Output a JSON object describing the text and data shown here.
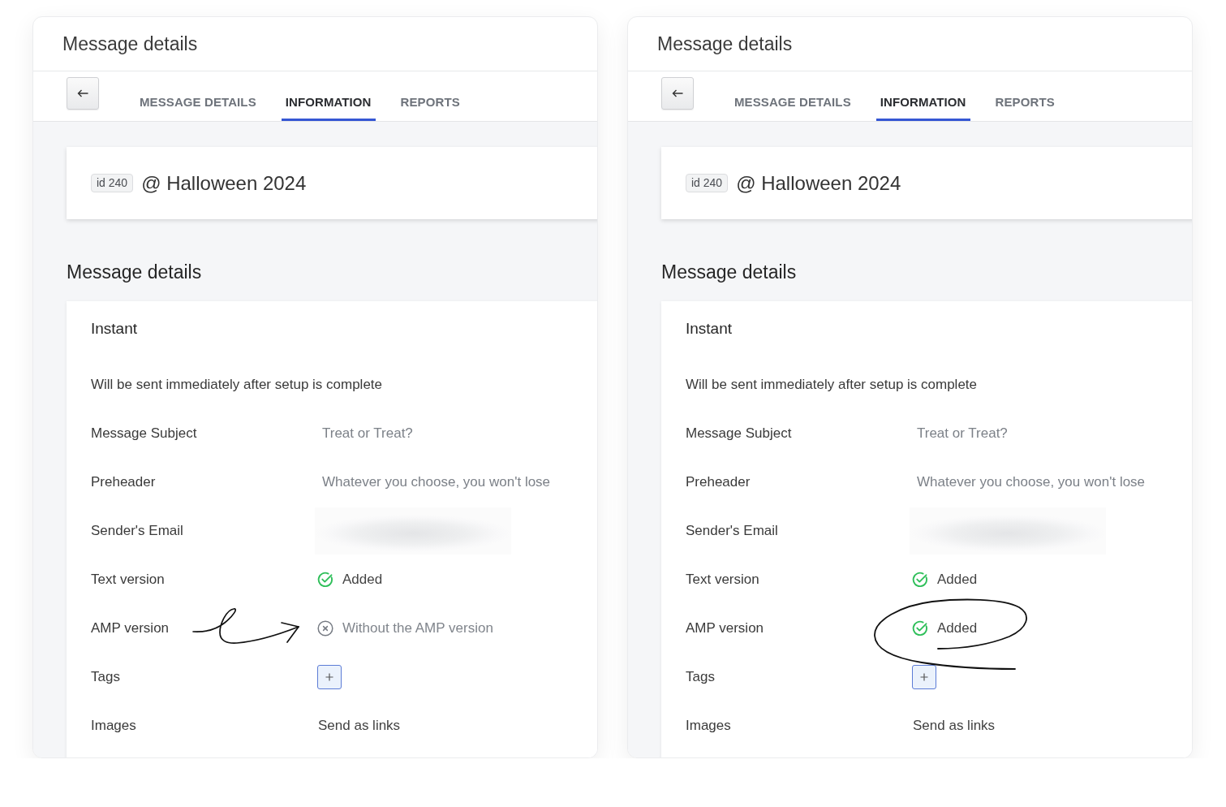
{
  "panels": [
    {
      "title": "Message details",
      "tabs": [
        {
          "label": "MESSAGE DETAILS",
          "selected": false
        },
        {
          "label": "INFORMATION",
          "selected": true
        },
        {
          "label": "REPORTS",
          "selected": false
        }
      ],
      "campaign": {
        "badge": "id 240",
        "name": "@ Halloween 2024"
      },
      "section_title": "Message details",
      "card": {
        "title": "Instant",
        "description": "Will be sent immediately after setup is complete",
        "rows": [
          {
            "label": "Message Subject",
            "kind": "text",
            "value": "Treat or Treat?"
          },
          {
            "label": "Preheader",
            "kind": "text",
            "value": "Whatever you choose, you won't lose"
          },
          {
            "label": "Sender's Email",
            "kind": "redacted"
          },
          {
            "label": "Text version",
            "kind": "status",
            "added": true,
            "value": "Added"
          },
          {
            "label": "AMP version",
            "kind": "status",
            "added": false,
            "value": "Without the AMP version"
          },
          {
            "label": "Tags",
            "kind": "add_button"
          },
          {
            "label": "Images",
            "kind": "plain",
            "value": "Send as links"
          }
        ]
      },
      "annotation": {
        "kind": "arrow"
      }
    },
    {
      "title": "Message details",
      "tabs": [
        {
          "label": "MESSAGE DETAILS",
          "selected": false
        },
        {
          "label": "INFORMATION",
          "selected": true
        },
        {
          "label": "REPORTS",
          "selected": false
        }
      ],
      "campaign": {
        "badge": "id 240",
        "name": "@ Halloween 2024"
      },
      "section_title": "Message details",
      "card": {
        "title": "Instant",
        "description": "Will be sent immediately after setup is complete",
        "rows": [
          {
            "label": "Message Subject",
            "kind": "text",
            "value": "Treat or Treat?"
          },
          {
            "label": "Preheader",
            "kind": "text",
            "value": "Whatever you choose, you won't lose"
          },
          {
            "label": "Sender's Email",
            "kind": "redacted"
          },
          {
            "label": "Text version",
            "kind": "status",
            "added": true,
            "value": "Added"
          },
          {
            "label": "AMP version",
            "kind": "status",
            "added": true,
            "value": "Added"
          },
          {
            "label": "Tags",
            "kind": "add_button"
          },
          {
            "label": "Images",
            "kind": "plain",
            "value": "Send as links"
          }
        ]
      },
      "annotation": {
        "kind": "ellipse"
      }
    }
  ]
}
